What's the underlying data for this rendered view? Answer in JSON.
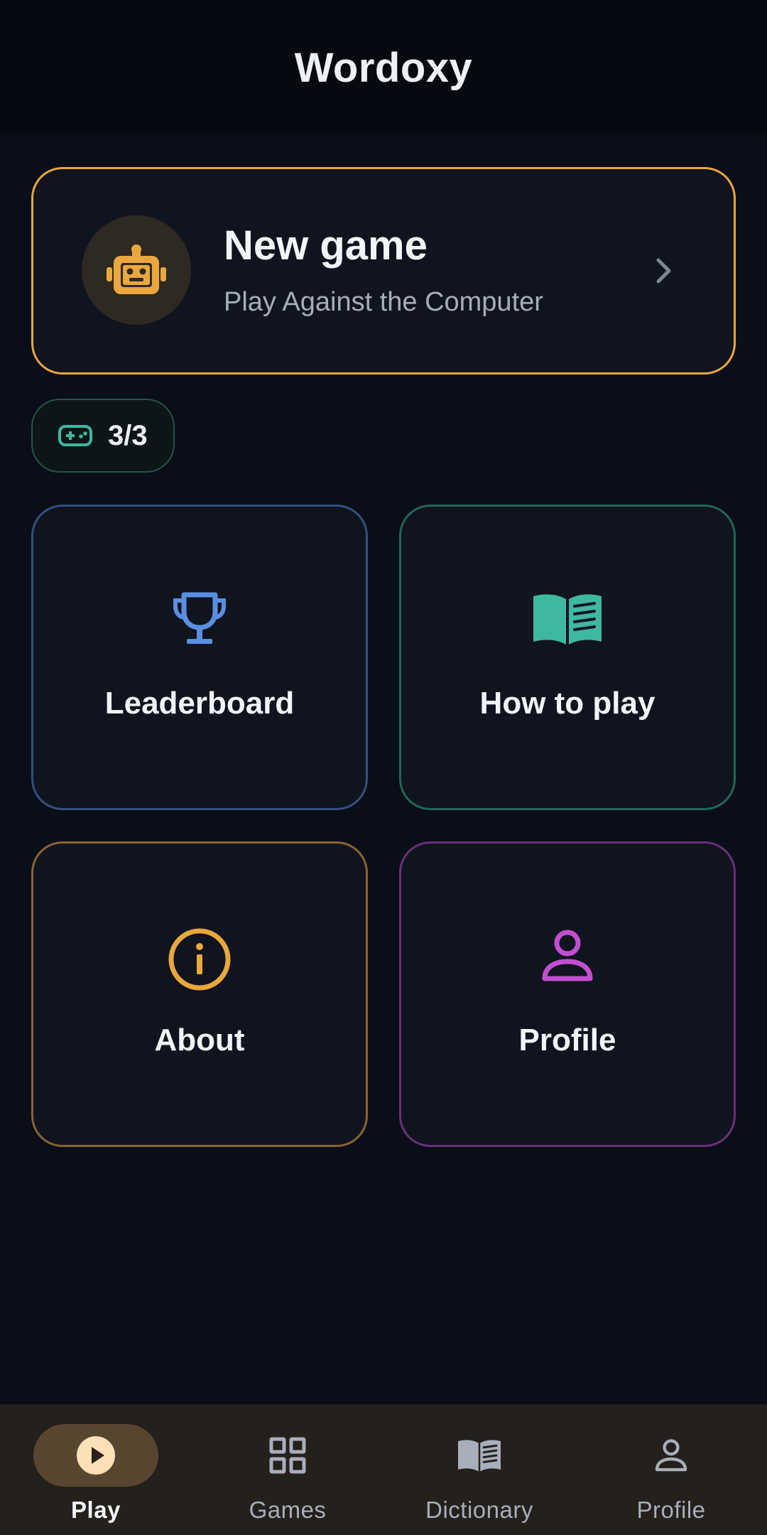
{
  "app": {
    "title": "Wordoxy"
  },
  "new_game": {
    "title": "New game",
    "subtitle": "Play Against the Computer",
    "icon": "robot-icon",
    "accent": "#e9a73d"
  },
  "games_counter": {
    "value": "3/3",
    "icon": "gamepad-icon",
    "accent": "#3fb8a0"
  },
  "tiles": [
    {
      "label": "Leaderboard",
      "icon": "trophy-icon",
      "accent": "#5a8fe0"
    },
    {
      "label": "How to play",
      "icon": "book-icon",
      "accent": "#3fb8a0"
    },
    {
      "label": "About",
      "icon": "info-icon",
      "accent": "#e9a73d"
    },
    {
      "label": "Profile",
      "icon": "person-icon",
      "accent": "#c24fd0"
    }
  ],
  "bottom_nav": {
    "items": [
      {
        "label": "Play",
        "icon": "play-icon",
        "active": true
      },
      {
        "label": "Games",
        "icon": "grid-icon",
        "active": false
      },
      {
        "label": "Dictionary",
        "icon": "book-icon",
        "active": false
      },
      {
        "label": "Profile",
        "icon": "person-icon",
        "active": false
      }
    ]
  }
}
